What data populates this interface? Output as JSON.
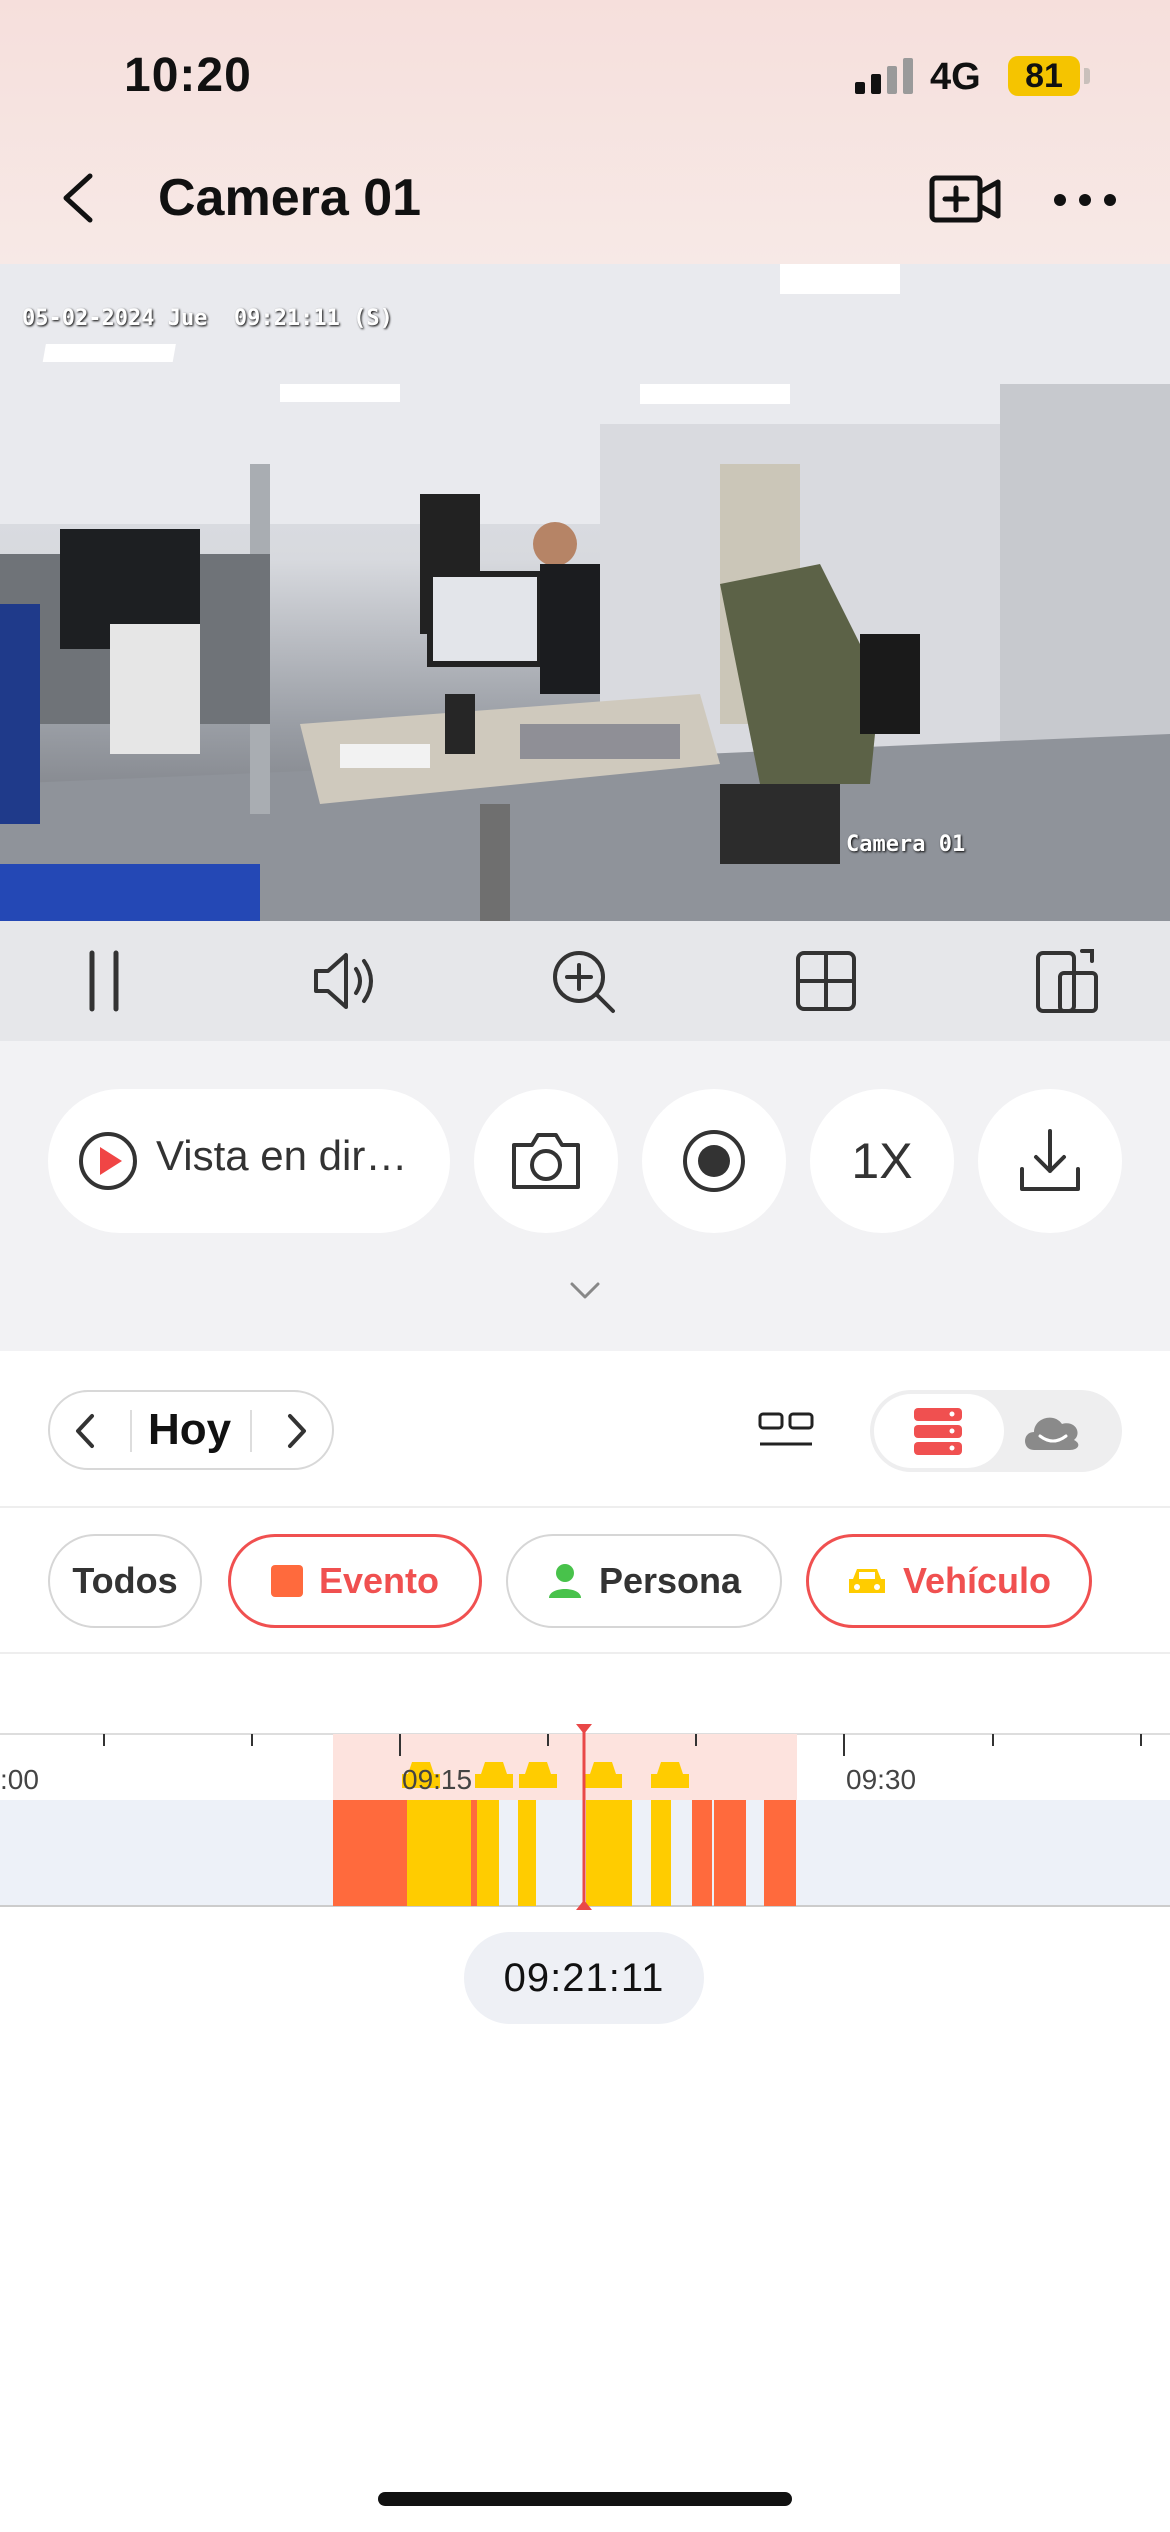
{
  "status_bar": {
    "time": "10:20",
    "network": "4G",
    "battery": "81"
  },
  "nav": {
    "title": "Camera 01",
    "back_icon": "chevron-left-icon",
    "record_icon": "video-add-icon",
    "more_icon": "more-horizontal-icon"
  },
  "video": {
    "timestamp_overlay": "05-02-2024 Jue  09:21:11 (S)",
    "camera_label_overlay": "Camera 01"
  },
  "controls": [
    "pause-icon",
    "speaker-icon",
    "zoom-in-icon",
    "grid-icon",
    "rotate-screen-icon"
  ],
  "actions": {
    "live_view_label": "Vista en dir…",
    "speed_label": "1X"
  },
  "date_nav": {
    "day_label": "Hoy"
  },
  "filters": {
    "all": "Todos",
    "event": "Evento",
    "person": "Persona",
    "vehicle": "Vehículo"
  },
  "timeline": {
    "tick_labels": [
      "09:15",
      "09:30"
    ],
    "left_partial_label": ":00",
    "current_time": "09:21:11"
  },
  "colors": {
    "accent_red": "#f05050",
    "event_orange": "#ff6a3d",
    "vehicle_yellow": "#ffcc00",
    "person_green": "#48c24b"
  }
}
